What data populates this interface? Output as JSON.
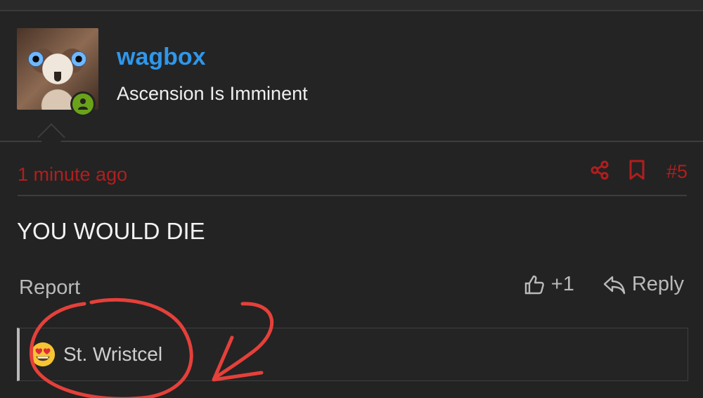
{
  "user": {
    "name": "wagbox",
    "title": "Ascension Is Imminent",
    "avatar_icon": "owl-avatar",
    "status_icon": "online-user-icon"
  },
  "post": {
    "time": "1 minute ago",
    "number": "#5",
    "content": "YOU WOULD DIE"
  },
  "actions": {
    "share_icon": "share-icon",
    "bookmark_icon": "bookmark-icon",
    "report_label": "Report",
    "like_count": "+1",
    "like_icon": "thumbs-up-icon",
    "reply_label": "Reply",
    "reply_icon": "reply-icon"
  },
  "reactions": {
    "emoji": "heart-eyes-emoji",
    "user": "St. Wristcel"
  },
  "colors": {
    "background": "#232323",
    "username": "#2f97ea",
    "accent_red": "#b11e1e",
    "online": "#6aa319",
    "annotation": "#e5403a"
  }
}
